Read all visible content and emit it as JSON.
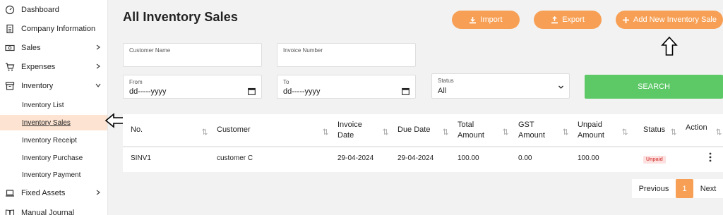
{
  "sidebar": {
    "items": [
      {
        "label": "Dashboard",
        "icon": "dashboard-icon"
      },
      {
        "label": "Company Information",
        "icon": "document-icon"
      },
      {
        "label": "Sales",
        "icon": "money-icon"
      },
      {
        "label": "Expenses",
        "icon": "cart-icon"
      },
      {
        "label": "Inventory",
        "icon": "inventory-icon"
      },
      {
        "label": "Fixed Assets",
        "icon": "laptop-icon"
      },
      {
        "label": "Manual Journal",
        "icon": "book-icon"
      }
    ],
    "inventory_subitems": [
      {
        "label": "Inventory List"
      },
      {
        "label": "Inventory Sales"
      },
      {
        "label": "Inventory Receipt"
      },
      {
        "label": "Inventory Purchase"
      },
      {
        "label": "Inventory Payment"
      }
    ]
  },
  "page": {
    "title": "All Inventory Sales"
  },
  "toolbar": {
    "import_label": "Import",
    "export_label": "Export",
    "add_label": "Add New Inventory Sale"
  },
  "filters": {
    "customer_name_label": "Customer Name",
    "invoice_number_label": "Invoice Number",
    "from_label": "From",
    "from_value": "dd-----yyyy",
    "to_label": "To",
    "to_value": "dd-----yyyy",
    "status_label": "Status",
    "status_value": "All",
    "search_label": "SEARCH"
  },
  "table": {
    "headers": {
      "no": "No.",
      "customer": "Customer",
      "invoice_date_1": "Invoice",
      "invoice_date_2": "Date",
      "due_date": "Due Date",
      "total_amount_1": "Total",
      "total_amount_2": "Amount",
      "gst_amount_1": "GST",
      "gst_amount_2": "Amount",
      "unpaid_amount_1": "Unpaid",
      "unpaid_amount_2": "Amount",
      "status": "Status",
      "action": "Action"
    },
    "rows": [
      {
        "no": "SINV1",
        "customer": "customer C",
        "invoice_date": "29-04-2024",
        "due_date": "29-04-2024",
        "total_amount": "100.00",
        "gst_amount": "0.00",
        "unpaid_amount": "100.00",
        "status": "Unpaid"
      }
    ]
  },
  "pagination": {
    "previous": "Previous",
    "current": "1",
    "next": "Next"
  },
  "colors": {
    "accent_orange": "#f7a055",
    "search_green": "#5cc866",
    "active_sidebar": "#fde4d2",
    "unpaid_badge": "#d9534f"
  }
}
